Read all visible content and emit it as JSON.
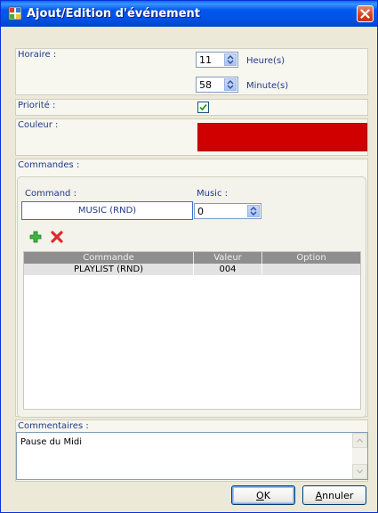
{
  "window": {
    "title": "Ajout/Edition d'événement",
    "close_icon": "close-icon",
    "title_icon": "app-icon"
  },
  "horaire": {
    "label": "Horaire :",
    "hour_value": "11",
    "hour_unit": "Heure(s)",
    "minute_value": "58",
    "minute_unit": "Minute(s)"
  },
  "priorite": {
    "label": "Priorité :",
    "checked": true
  },
  "couleur": {
    "label": "Couleur :",
    "color": "#d00000"
  },
  "commandes": {
    "label": "Commandes :",
    "command_label": "Command :",
    "command_value": "MUSIC (RND)",
    "music_label": "Music :",
    "music_value": "0",
    "add_icon": "plus-icon",
    "delete_icon": "cross-icon",
    "columns": [
      "Commande",
      "Valeur",
      "Option"
    ],
    "rows": [
      [
        "PLAYLIST (RND)",
        "004",
        ""
      ]
    ]
  },
  "commentaires": {
    "label": "Commentaires :",
    "value": "Pause du Midi"
  },
  "buttons": {
    "ok_prefix": "O",
    "ok_rest": "K",
    "cancel_prefix": "A",
    "cancel_rest": "nnuler"
  }
}
